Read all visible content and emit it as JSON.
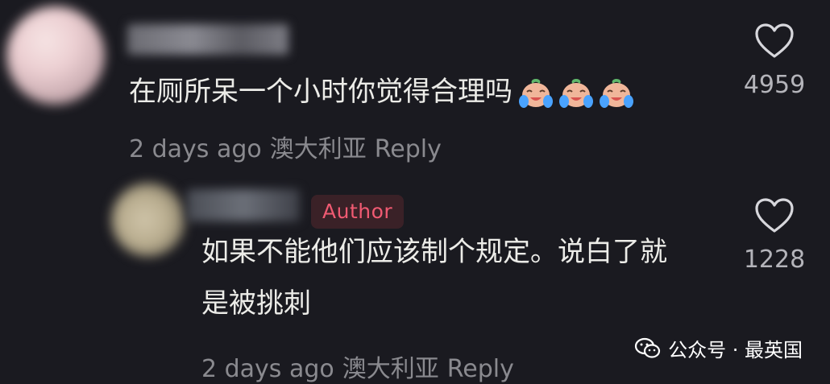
{
  "comments": [
    {
      "text": "在厕所呆一个小时你觉得合理吗",
      "emojis": [
        "crying-face-icon",
        "crying-face-icon",
        "crying-face-icon"
      ],
      "time": "2 days ago",
      "location": "澳大利亚",
      "reply_label": "Reply",
      "like_count": "4959",
      "author_badge": ""
    },
    {
      "text": "如果不能他们应该制个规定。说白了就是被挑刺",
      "time": "2 days ago",
      "location": "澳大利亚",
      "reply_label": "Reply",
      "like_count": "1228",
      "author_badge": "Author"
    }
  ],
  "watermark": {
    "text": "公众号 · 最英国",
    "icon": "wechat-icon"
  },
  "colors": {
    "background": "#1a1a20",
    "author_badge_text": "#f05a72",
    "author_badge_bg": "#3a2127",
    "meta_text": "#8a8a8f"
  }
}
